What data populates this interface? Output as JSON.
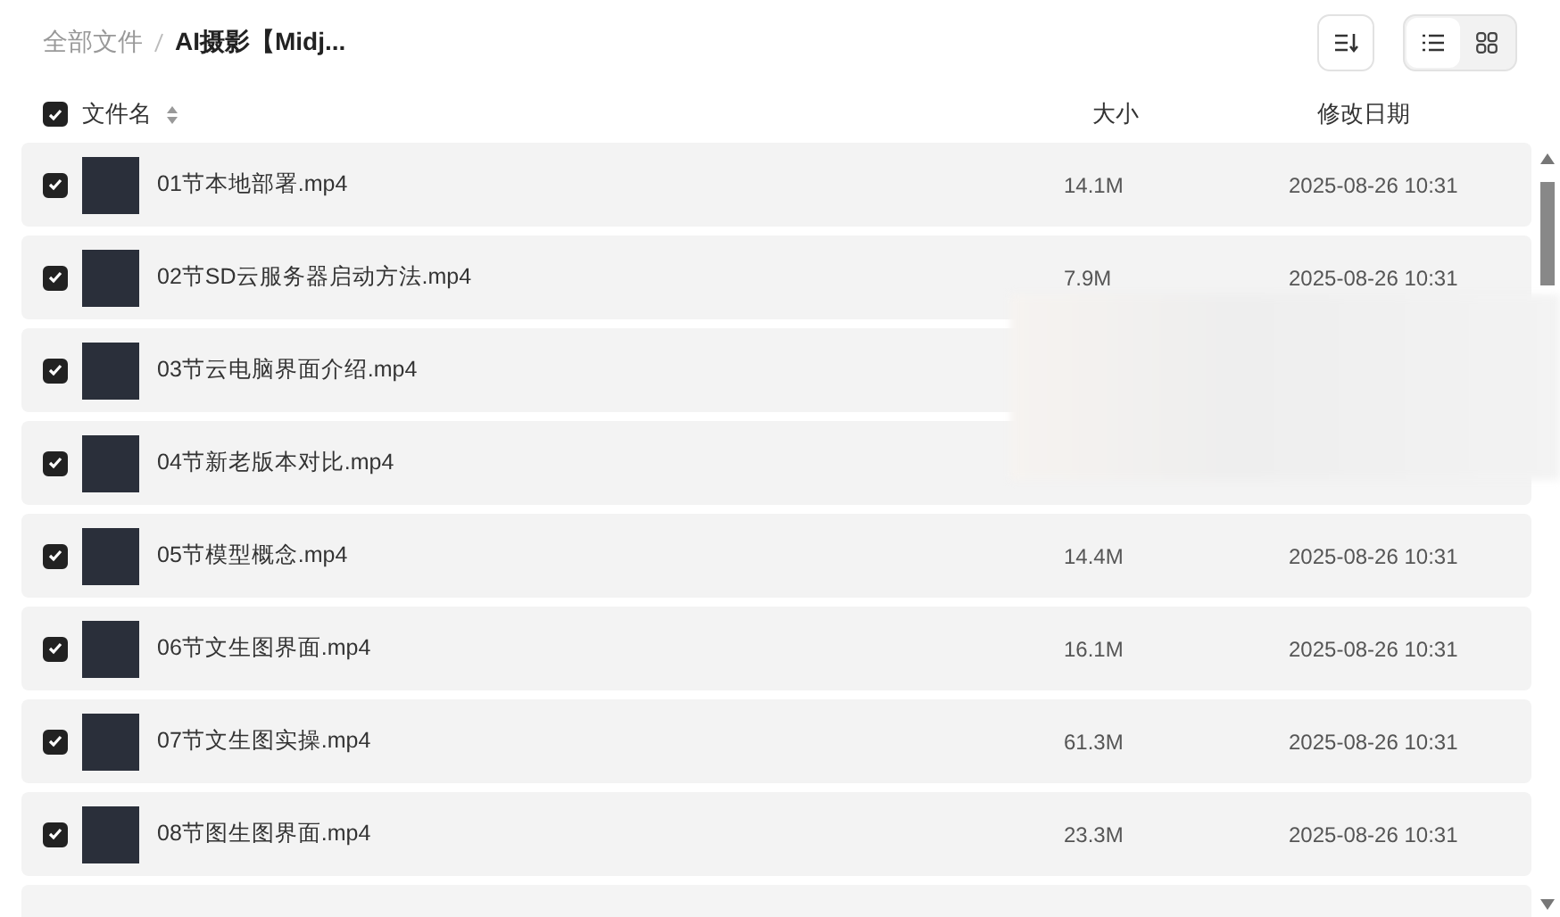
{
  "breadcrumb": [
    {
      "label": "全部文件",
      "current": false
    },
    {
      "label": "AI摄影【Midj...",
      "current": true
    }
  ],
  "view_toggle": [
    {
      "kind": "list",
      "selected": true
    },
    {
      "kind": "grid",
      "selected": false
    }
  ],
  "header": {
    "checked": true,
    "name": "文件名",
    "size": "大小",
    "date": "修改日期"
  },
  "rows": [
    {
      "checked": true,
      "name": "01节本地部署.mp4",
      "size": "14.1M",
      "date": "2025-08-26 10:31"
    },
    {
      "checked": true,
      "name": "02节SD云服务器启动方法.mp4",
      "size": "7.9M",
      "date": "2025-08-26 10:31"
    },
    {
      "checked": true,
      "name": "03节云电脑界面介绍.mp4"
    },
    {
      "checked": true,
      "name": "04节新老版本对比.mp4"
    },
    {
      "checked": true,
      "name": "05节模型概念.mp4",
      "size": "14.4M",
      "date": "2025-08-26 10:31"
    },
    {
      "checked": true,
      "name": "06节文生图界面.mp4",
      "size": "16.1M",
      "date": "2025-08-26 10:31"
    },
    {
      "checked": true,
      "name": "07节文生图实操.mp4",
      "size": "61.3M",
      "date": "2025-08-26 10:31"
    },
    {
      "checked": true,
      "name": "08节图生图界面.mp4",
      "size": "23.3M",
      "date": "2025-08-26 10:31"
    }
  ]
}
